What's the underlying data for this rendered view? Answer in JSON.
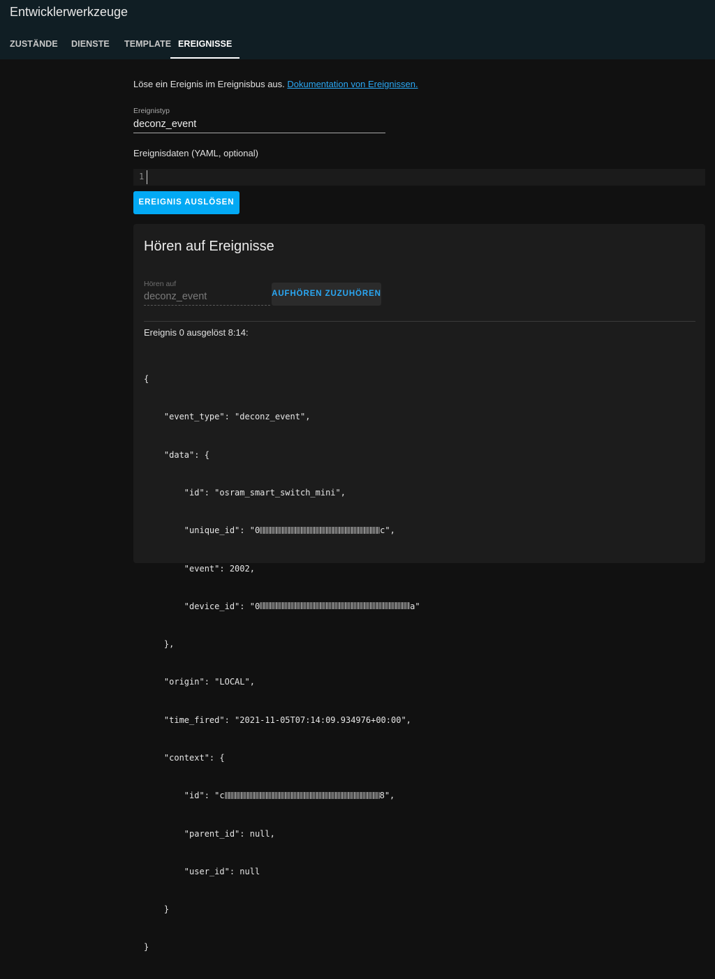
{
  "app": {
    "title": "Entwicklerwerkzeuge"
  },
  "tabs": [
    {
      "label": "ZUSTÄNDE",
      "active": false
    },
    {
      "label": "DIENSTE",
      "active": false
    },
    {
      "label": "TEMPLATE",
      "active": false
    },
    {
      "label": "EREIGNISSE",
      "active": true
    }
  ],
  "intro": {
    "text": "Löse ein Ereignis im Ereignisbus aus. ",
    "link": "Dokumentation von Ereignissen."
  },
  "event_type": {
    "label": "Ereignistyp",
    "value": "deconz_event"
  },
  "event_data": {
    "label": "Ereignisdaten (YAML, optional)",
    "line_number": "1"
  },
  "fire_button": {
    "label": "EREIGNIS AUSLÖSEN"
  },
  "listen": {
    "title": "Hören auf Ereignisse",
    "input_label": "Hören auf",
    "input_value": "deconz_event",
    "stop_button": "AUFHÖREN ZUZUHÖREN",
    "event_header": "Ereignis 0 ausgelöst 8:14:"
  },
  "event_json": {
    "open": "{",
    "event_type_line": "    \"event_type\": \"deconz_event\",",
    "data_open": "    \"data\": {",
    "id_line": "        \"id\": \"osram_smart_switch_mini\",",
    "unique_id_prefix": "        \"unique_id\": \"0",
    "unique_id_suffix": "c\",",
    "event_line": "        \"event\": 2002,",
    "device_id_prefix": "        \"device_id\": \"0",
    "device_id_suffix": "a\"",
    "data_close": "    },",
    "origin_line": "    \"origin\": \"LOCAL\",",
    "time_fired_line": "    \"time_fired\": \"2021-11-05T07:14:09.934976+00:00\",",
    "context_open": "    \"context\": {",
    "context_id_prefix": "        \"id\": \"c",
    "context_id_suffix": "8\",",
    "parent_id_line": "        \"parent_id\": null,",
    "user_id_line": "        \"user_id\": null",
    "context_close": "    }",
    "close": "}"
  },
  "colors": {
    "header_bg": "#101e24",
    "page_bg": "#111111",
    "card_bg": "#1c1c1c",
    "accent": "#03a9f4",
    "link": "#2aa7f3"
  }
}
